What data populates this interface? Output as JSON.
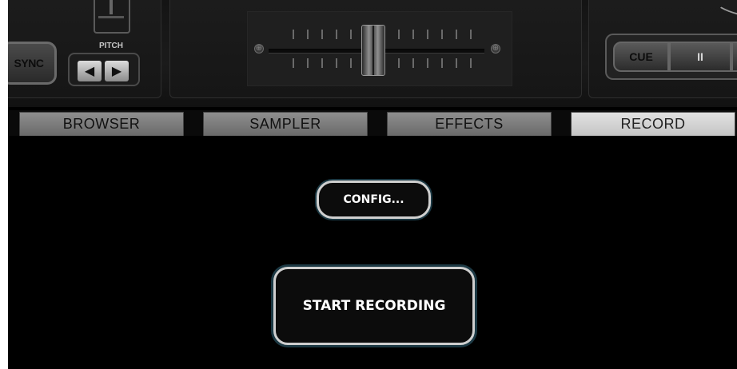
{
  "deck": {
    "sync_label": "SYNC",
    "pitch_label": "PITCH",
    "pitch_left_symbol": "◀",
    "pitch_right_symbol": "▶",
    "cue_label": "CUE",
    "pause_symbol": "II"
  },
  "tabs": [
    {
      "label": "BROWSER",
      "active": false
    },
    {
      "label": "SAMPLER",
      "active": false
    },
    {
      "label": "EFFECTS",
      "active": false
    },
    {
      "label": "RECORD",
      "active": true
    }
  ],
  "record": {
    "config_label": "CONFIG...",
    "start_label": "START RECORDING"
  },
  "colors": {
    "background": "#000000",
    "button_border": "#cfcfcf",
    "button_glow": "#1c3944",
    "active_tab": "#d4d4d4",
    "inactive_tab": "#7c7c7c"
  }
}
